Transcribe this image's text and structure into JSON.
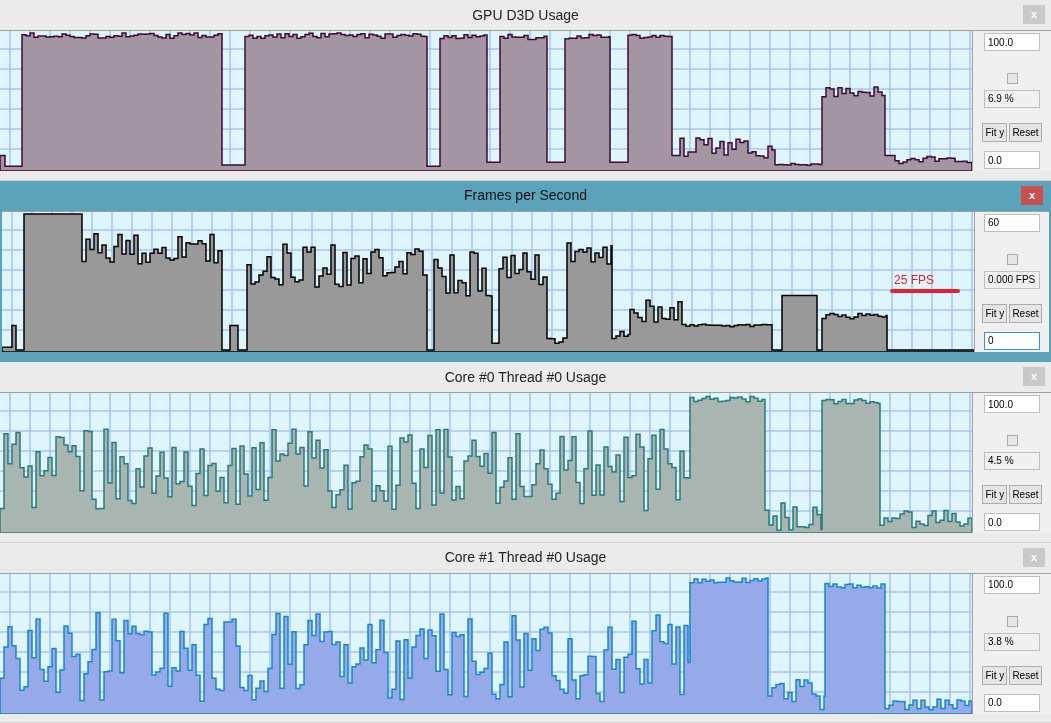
{
  "panels": [
    {
      "title": "GPU D3D Usage",
      "selected": false,
      "color": "#a495a3",
      "close": "x",
      "y_max": "100.0",
      "checked": false,
      "reading": "6.9 %",
      "buttons": [
        "Fit y",
        "Reset"
      ],
      "y_min": "0.0"
    },
    {
      "title": "Frames per Second",
      "selected": true,
      "color": "#999999",
      "close": "x",
      "y_max": "60",
      "checked": false,
      "reading": "0.000 FPS",
      "buttons": [
        "Fit y",
        "Reset"
      ],
      "y_min": "0",
      "annotation": "25 FPS"
    },
    {
      "title": "Core #0 Thread #0 Usage",
      "selected": false,
      "color": "#a9b5b1",
      "close": "x",
      "y_max": "100.0",
      "checked": false,
      "reading": "4.5 %",
      "buttons": [
        "Fit y",
        "Reset"
      ],
      "y_min": "0.0"
    },
    {
      "title": "Core #1 Thread #0 Usage",
      "selected": false,
      "color": "#96a9e8",
      "close": "x",
      "y_max": "100.0",
      "checked": false,
      "reading": "3.8 %",
      "buttons": [
        "Fit y",
        "Reset"
      ],
      "y_min": "0.0"
    }
  ]
}
